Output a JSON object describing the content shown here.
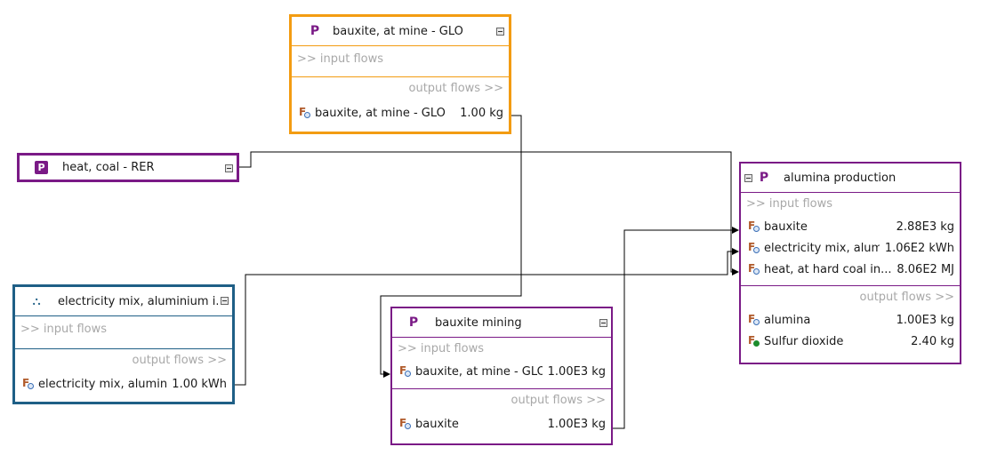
{
  "nodes": {
    "bauxite_glo": {
      "title": "bauxite, at mine - GLO",
      "input_section": ">> input flows",
      "output_section": "output flows >>",
      "outputs": [
        {
          "name": "bauxite, at mine - GLO",
          "amount": "1.00 kg"
        }
      ]
    },
    "heat_coal": {
      "title": "heat, coal - RER"
    },
    "electricity": {
      "title": "electricity mix, aluminium i...",
      "input_section": ">> input flows",
      "output_section": "output flows >>",
      "outputs": [
        {
          "name": "electricity mix, alumini...",
          "amount": "1.00 kWh"
        }
      ]
    },
    "bauxite_mining": {
      "title": "bauxite mining",
      "input_section": ">> input flows",
      "output_section": "output flows >>",
      "inputs": [
        {
          "name": "bauxite, at mine - GLO",
          "amount": "1.00E3 kg"
        }
      ],
      "outputs": [
        {
          "name": "bauxite",
          "amount": "1.00E3 kg"
        }
      ]
    },
    "alumina": {
      "title": "alumina production",
      "input_section": ">> input flows",
      "output_section": "output flows >>",
      "inputs": [
        {
          "name": "bauxite",
          "amount": "2.88E3 kg"
        },
        {
          "name": "electricity mix, alumi...",
          "amount": "1.06E2 kWh"
        },
        {
          "name": "heat, at hard coal in...",
          "amount": "8.06E2 MJ"
        }
      ],
      "outputs": [
        {
          "name": "alumina",
          "amount": "1.00E3 kg"
        },
        {
          "name": "Sulfur dioxide",
          "amount": "2.40 kg"
        }
      ]
    }
  },
  "icons": {
    "process": "P",
    "flow": "F"
  },
  "colors": {
    "process_border": "#7a1a86",
    "selected_border": "#f39c12",
    "system_border": "#1f5f86",
    "link": "#000000"
  }
}
